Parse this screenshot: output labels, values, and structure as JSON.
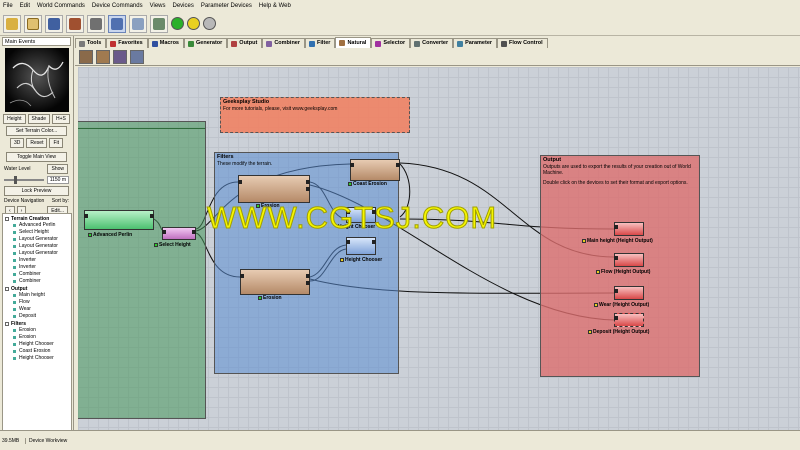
{
  "menu": [
    "File",
    "Edit",
    "World Commands",
    "Device Commands",
    "Views",
    "Devices",
    "Parameter Devices",
    "Help & Web"
  ],
  "toolbar_icons": [
    "new-icon",
    "open-icon",
    "save-icon",
    "tools-icon",
    "build-icon",
    "workview-icon",
    "layout-view-icon",
    "3d-view-icon",
    "build-green-icon",
    "build-yellow-icon",
    "stop-icon"
  ],
  "left_panel": {
    "title": "Main Events",
    "view_buttons": [
      "Height",
      "Shade",
      "H+S"
    ],
    "terrain_color": "Set Terrain Color...",
    "view_modes": [
      "3D",
      "Reset",
      "Fit"
    ],
    "toggle_main_view": "Toggle Main View",
    "water_level_label": "Water Level",
    "show_label": "Show",
    "water_value": "1150 m",
    "lock_preview": "Lock Preview",
    "device_navigation": "Device Navigation",
    "sort_by": "Sort by:",
    "edit_label": "Edit..."
  },
  "tree": [
    {
      "group": "Terrain Creation",
      "items": [
        "Advanced Perlin",
        "Select Height",
        "Layout Generator",
        "Layout Generator",
        "Layout Generator",
        "Inverter",
        "Inverter",
        "Combiner",
        "Combiner"
      ]
    },
    {
      "group": "Output",
      "items": [
        "Main height",
        "Flow",
        "Wear",
        "Deposit"
      ]
    },
    {
      "group": "Filters",
      "items": [
        "Erosion",
        "Erosion",
        "Height Chooser",
        "Coast Erosion",
        "Height Chooser"
      ]
    }
  ],
  "tabs": [
    {
      "label": "Tools",
      "color": "#7a7a7a"
    },
    {
      "label": "Favorites",
      "color": "#c03030"
    },
    {
      "label": "Macros",
      "color": "#3050a0"
    },
    {
      "label": "Generator",
      "color": "#3a8a3a"
    },
    {
      "label": "Output",
      "color": "#b04040"
    },
    {
      "label": "Combiner",
      "color": "#8060a0"
    },
    {
      "label": "Filter",
      "color": "#3070b0"
    },
    {
      "label": "Natural",
      "color": "#a07040",
      "active": true
    },
    {
      "label": "Selector",
      "color": "#a030a0"
    },
    {
      "label": "Converter",
      "color": "#607070"
    },
    {
      "label": "Parameter",
      "color": "#4080a0"
    },
    {
      "label": "Flow Control",
      "color": "#505050"
    }
  ],
  "palette_colors": [
    "#8a6a4a",
    "#a07a50",
    "#6a5a8a",
    "#6a7aa0"
  ],
  "groups": {
    "note": {
      "title": "Geeksplay Studio",
      "desc": "For more tutorials, please, visit www.geeksplay.com"
    },
    "filters": {
      "title": "Filters",
      "desc": "These modify the terrain."
    },
    "output": {
      "title": "Output",
      "desc1": "Outputs are used to export the results of your creation out of World Machine.",
      "desc2": "Double click on the devices to set their format and export options."
    }
  },
  "devices": {
    "advanced_perlin": "Advanced Perlin",
    "select_height": "Select Height",
    "erosion_top": "Erosion",
    "erosion_bottom": "Erosion",
    "coast_erosion": "Coast Erosion",
    "height_chooser_a": "Height Chooser",
    "height_chooser_b": "Height Chooser",
    "out_main": "Main height (Height Output)",
    "out_flow": "Flow (Height Output)",
    "out_wear": "Wear (Height Output)",
    "out_deposit": "Deposit (Height Output)"
  },
  "watermark": "WWW.CGTSJ.COM",
  "status": {
    "memory": "39.5MB",
    "view": "Device Workview"
  }
}
